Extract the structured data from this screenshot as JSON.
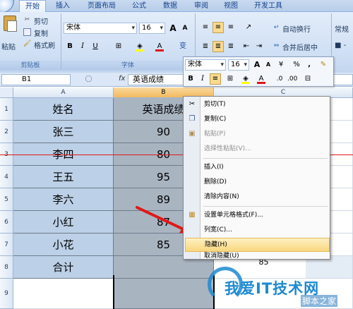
{
  "ribbon": {
    "tabs": [
      "开始",
      "插入",
      "页面布局",
      "公式",
      "数据",
      "审阅",
      "视图",
      "开发工具"
    ],
    "clipboard": {
      "paste": "粘贴",
      "cut": "剪切",
      "copy": "复制",
      "format_painter": "格式刷",
      "group_label": "剪贴板"
    },
    "font": {
      "name": "宋体",
      "size": "16",
      "grow": "A",
      "shrink": "A",
      "bold": "B",
      "italic": "I",
      "underline": "U",
      "group_label": "字体",
      "change_case": "变"
    },
    "alignment": {
      "wrap_text": "自动换行",
      "merge_center": "合并后居中"
    },
    "number": {
      "format": "常规"
    }
  },
  "formula_bar": {
    "name_box": "B1",
    "fx": "fx",
    "content": "英语成绩"
  },
  "columns": [
    "A",
    "B",
    "C"
  ],
  "rows": [
    "1",
    "2",
    "3",
    "4",
    "5",
    "6",
    "7",
    "8",
    "9"
  ],
  "cells": {
    "A": [
      "姓名",
      "张三",
      "李四",
      "王五",
      "李六",
      "小红",
      "小花",
      "合计",
      ""
    ],
    "B": [
      "英语成绩",
      "90",
      "80",
      "95",
      "89",
      "87",
      "85",
      "",
      ""
    ],
    "C": [
      "",
      "",
      "",
      "",
      "",
      "",
      "",
      "85",
      ""
    ]
  },
  "mini_toolbar": {
    "font": "宋体",
    "size": "16",
    "grow": "A",
    "shrink": "A",
    "currency": "¥",
    "percent": "%",
    "comma": ",",
    "bold": "B",
    "italic": "I",
    "align": "≡"
  },
  "context_menu": {
    "items": [
      {
        "label": "剪切(T)",
        "icon": "scissors-icon",
        "disabled": false
      },
      {
        "label": "复制(C)",
        "icon": "copy-icon",
        "disabled": false
      },
      {
        "label": "粘贴(P)",
        "icon": "paste-icon",
        "disabled": true
      },
      {
        "label": "选择性粘贴(V)...",
        "icon": "",
        "disabled": true
      },
      {
        "label": "插入(I)",
        "icon": "",
        "disabled": false
      },
      {
        "label": "删除(D)",
        "icon": "",
        "disabled": false
      },
      {
        "label": "清除内容(N)",
        "icon": "",
        "disabled": false
      },
      {
        "label": "设置单元格格式(F)...",
        "icon": "format-cells-icon",
        "disabled": false
      },
      {
        "label": "列宽(C)...",
        "icon": "",
        "disabled": false
      },
      {
        "label": "隐藏(H)",
        "icon": "",
        "disabled": false,
        "highlighted": true
      },
      {
        "label": "取消隐藏(U)",
        "icon": "",
        "disabled": false
      }
    ]
  },
  "watermark": {
    "text": "我爱IT技术网",
    "sub": "脚本之家"
  },
  "colors": {
    "selection_column": "#a9b4c1",
    "column_a": "#bcd0e7",
    "highlight": "#f9d77f",
    "red_line": "#e01818",
    "arrow": "#e01818"
  }
}
